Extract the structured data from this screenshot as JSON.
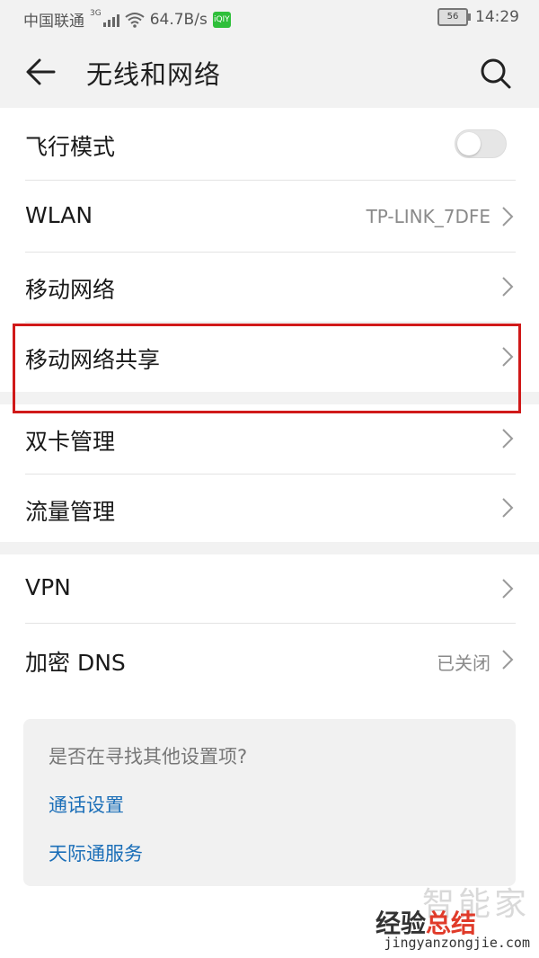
{
  "status_bar": {
    "carrier": "中国联通",
    "network_type": "3G",
    "speed": "64.7B/s",
    "app_badge": "iQIY",
    "battery": "56",
    "time": "14:29"
  },
  "app_bar": {
    "title": "无线和网络",
    "back_icon": "back-arrow-icon",
    "search_icon": "search-icon"
  },
  "items": [
    {
      "label": "飞行模式",
      "control": "toggle",
      "toggle_on": false
    },
    {
      "label": "WLAN",
      "value": "TP-LINK_7DFE"
    },
    {
      "label": "移动网络"
    },
    {
      "label": "移动网络共享",
      "highlighted": true
    },
    {
      "label": "双卡管理"
    },
    {
      "label": "流量管理"
    },
    {
      "label": "VPN"
    },
    {
      "label": "加密 DNS",
      "value": "已关闭"
    }
  ],
  "suggestions": {
    "question": "是否在寻找其他设置项?",
    "links": [
      "通话设置",
      "天际通服务"
    ]
  },
  "watermark": {
    "top": "智能家",
    "brand_a": "经验",
    "brand_b": "总结",
    "url": "jingyanzongjie.com"
  },
  "colors": {
    "highlight_border": "#d01919",
    "link": "#1c6fb8",
    "iqiyi_green": "#2fbf3a"
  }
}
